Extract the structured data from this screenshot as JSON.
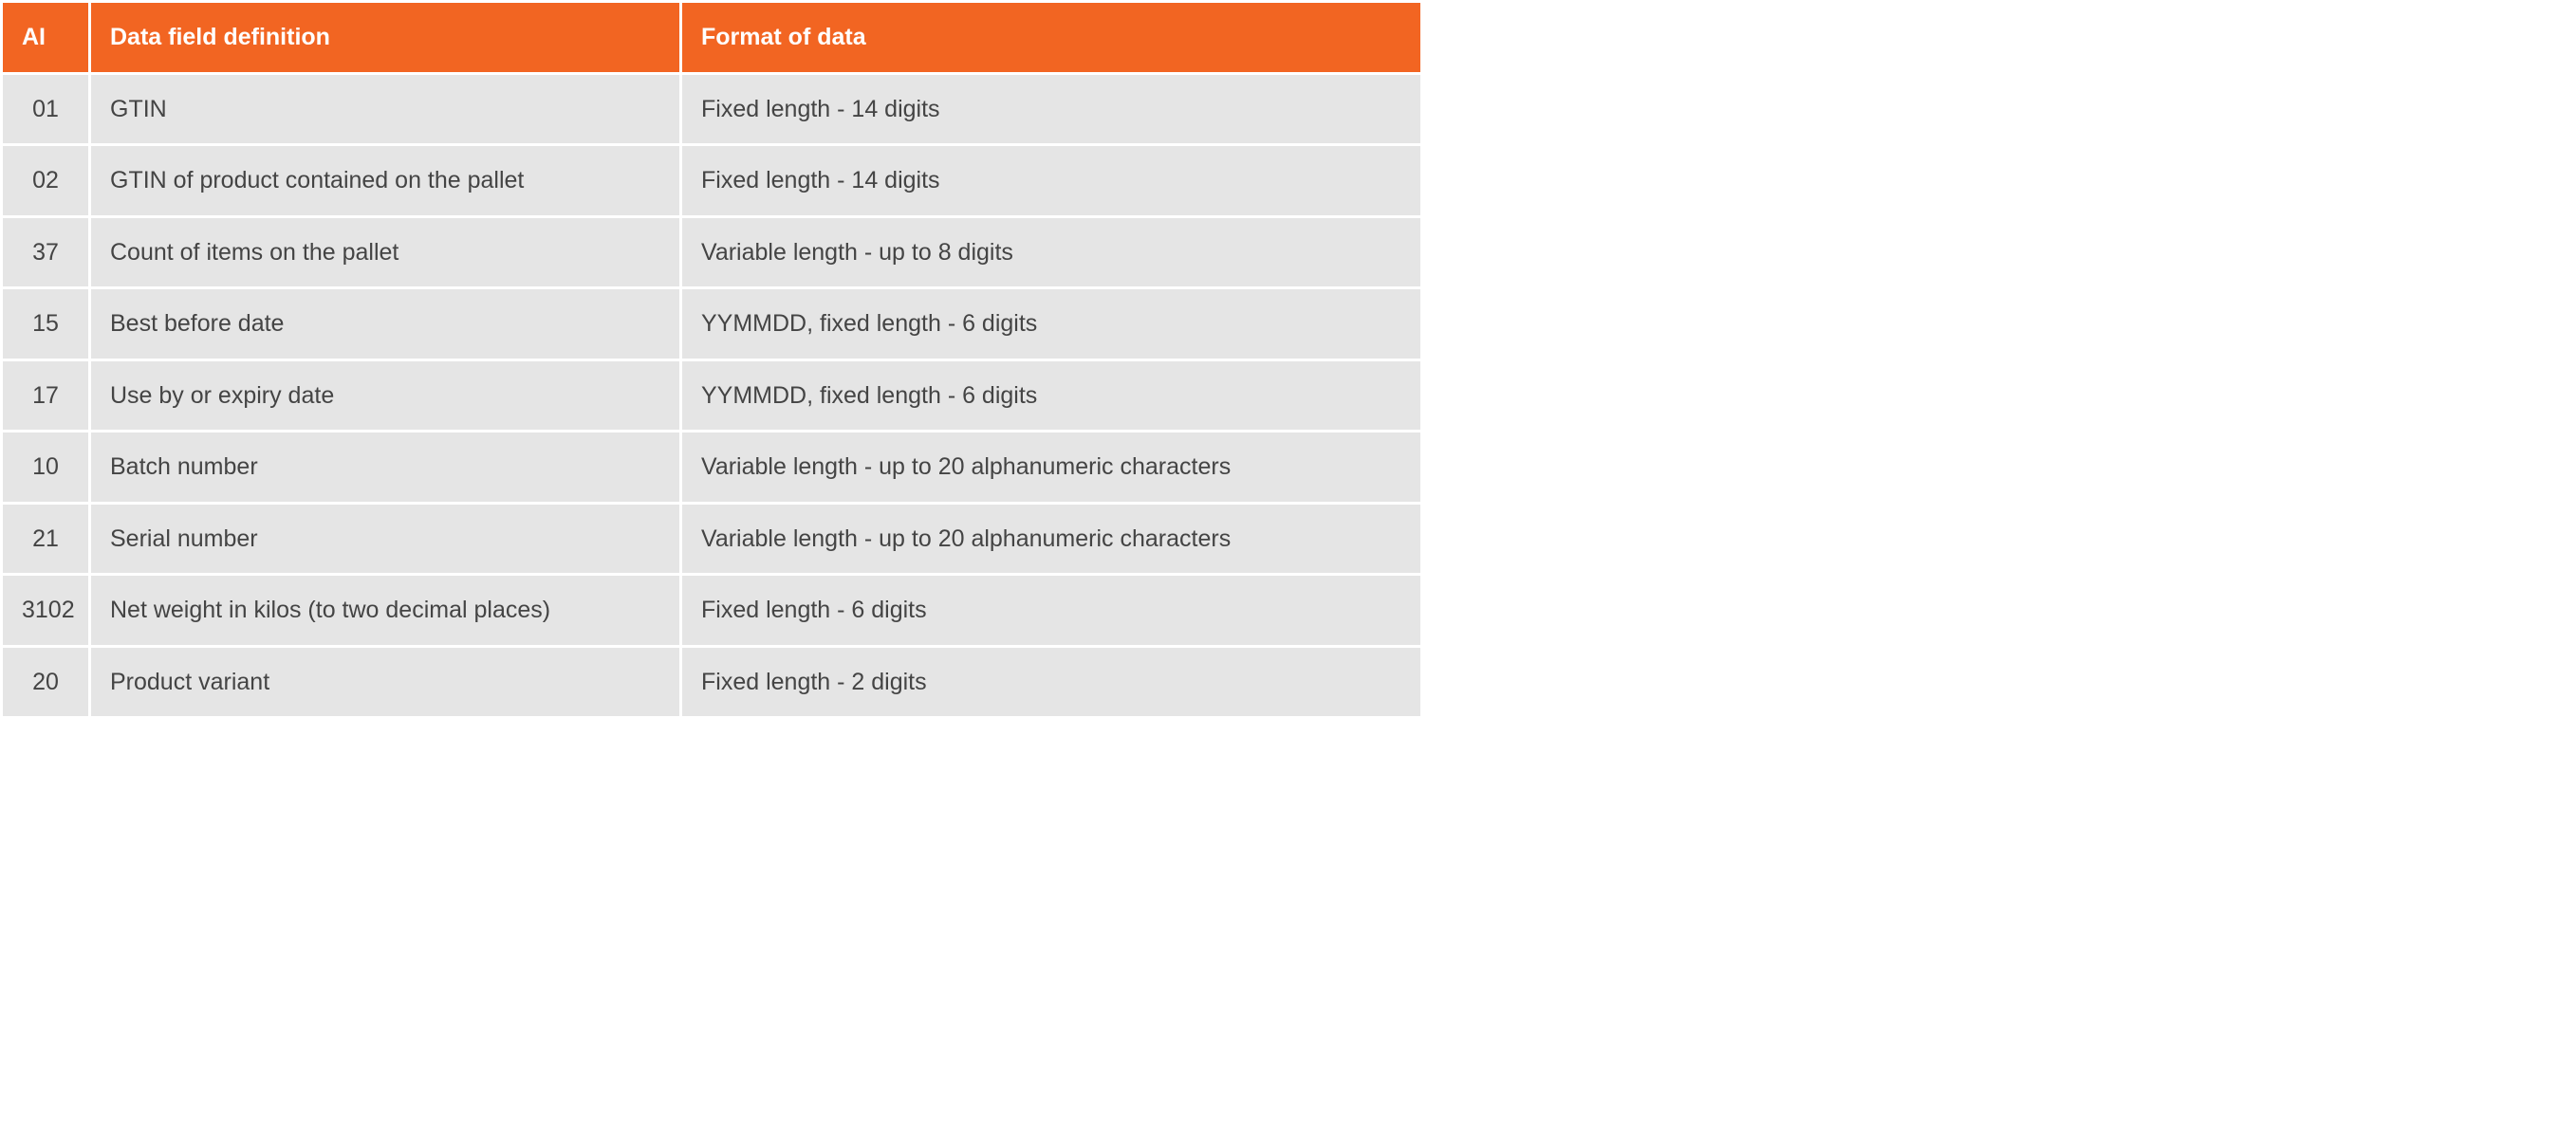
{
  "table": {
    "headers": {
      "ai": "AI",
      "definition": "Data field definition",
      "format": "Format of data"
    },
    "rows": [
      {
        "ai": "01",
        "definition": "GTIN",
        "format": "Fixed length - 14 digits"
      },
      {
        "ai": "02",
        "definition": "GTIN of product contained on the pallet",
        "format": "Fixed length - 14 digits"
      },
      {
        "ai": "37",
        "definition": "Count of items on the pallet",
        "format": "Variable length - up to 8 digits"
      },
      {
        "ai": "15",
        "definition": "Best before date",
        "format": "YYMMDD, fixed length - 6 digits"
      },
      {
        "ai": "17",
        "definition": "Use by or expiry date",
        "format": "YYMMDD, fixed length - 6 digits"
      },
      {
        "ai": "10",
        "definition": "Batch number",
        "format": "Variable length - up to 20 alphanumeric characters"
      },
      {
        "ai": "21",
        "definition": "Serial number",
        "format": "Variable length - up to 20 alphanumeric characters"
      },
      {
        "ai": "3102",
        "definition": "Net weight in kilos (to two decimal places)",
        "format": "Fixed length - 6 digits"
      },
      {
        "ai": "20",
        "definition": "Product variant",
        "format": "Fixed length - 2 digits"
      }
    ]
  }
}
